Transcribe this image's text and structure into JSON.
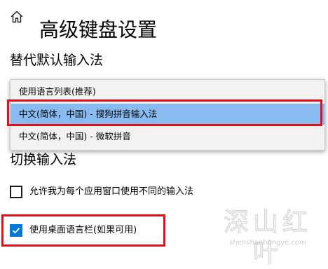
{
  "header": {
    "title": "高级键盘设置",
    "home_icon": "home-icon"
  },
  "default_ime": {
    "title": "替代默认输入法",
    "options": [
      "使用语言列表(推荐)",
      "中文(简体，中国) - 搜狗拼音输入法",
      "中文(简体，中国) - 微软拼音"
    ],
    "selected_index": 1
  },
  "switch_ime": {
    "title": "切换输入法",
    "per_app_label": "允许我为每个应用窗口使用不同的输入法",
    "per_app_checked": false,
    "langbar_label": "使用桌面语言栏(如果可用)",
    "langbar_checked": true
  },
  "watermark": {
    "main": "深山红叶",
    "sub": "shenshanhongye.com"
  },
  "colors": {
    "highlight_border": "#e0101c",
    "selected_option_bg": "#88bbf0",
    "checkbox_checked": "#0078d7",
    "dropdown_bg": "#f2f2f2"
  }
}
